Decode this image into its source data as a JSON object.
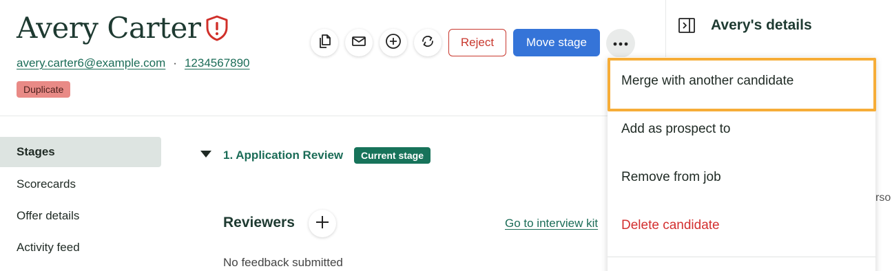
{
  "candidate": {
    "name": "Avery Carter",
    "email": "avery.carter6@example.com",
    "separator": "·",
    "phone": "1234567890",
    "flag_label": "Duplicate"
  },
  "actions": {
    "icons": [
      "copy-icon",
      "mail-icon",
      "add-circle-icon",
      "refresh-icon"
    ],
    "reject_label": "Reject",
    "move_stage_label": "Move stage",
    "more_icon": "more-horizontal-icon"
  },
  "details_panel": {
    "title": "Avery's details",
    "truncated_text": "rso"
  },
  "nav": {
    "items": [
      {
        "label": "Stages",
        "active": true
      },
      {
        "label": "Scorecards",
        "active": false
      },
      {
        "label": "Offer details",
        "active": false
      },
      {
        "label": "Activity feed",
        "active": false
      }
    ]
  },
  "stage": {
    "title": "1. Application Review",
    "badge": "Current stage",
    "reviewers_label": "Reviewers",
    "interview_kit_link": "Go to interview kit",
    "feedback_text": "No feedback submitted"
  },
  "menu": {
    "items": [
      {
        "label": "Merge with another candidate",
        "highlighted": true
      },
      {
        "label": "Add as prospect to",
        "highlighted": false
      },
      {
        "label": "Remove from job",
        "highlighted": false
      },
      {
        "label": "Delete candidate",
        "danger": true
      }
    ]
  },
  "colors": {
    "brand_green": "#1b6c57",
    "primary_blue": "#3574d8",
    "danger_red": "#c8372d",
    "highlight_orange": "#f6ad38",
    "duplicate_badge": "#e98a86"
  }
}
